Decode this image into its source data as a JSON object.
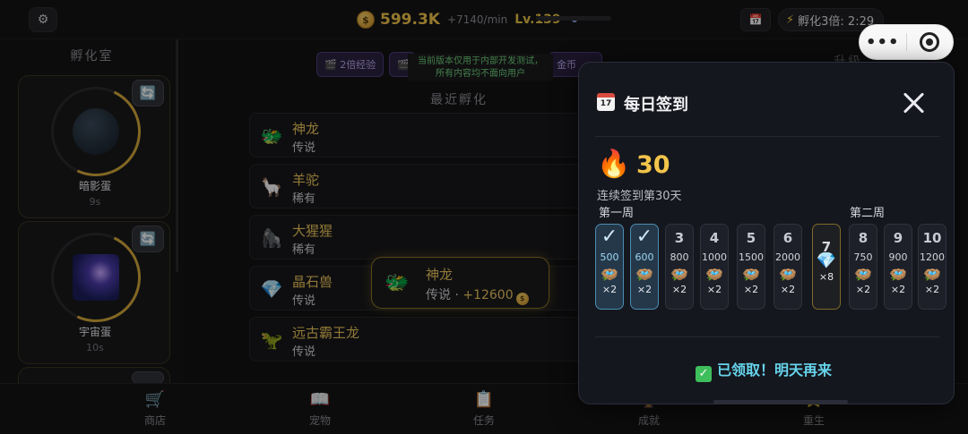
{
  "header": {
    "coins": "599.3K",
    "rate": "+7140/min",
    "level": "Lv.139",
    "level_progress": 0.0,
    "boost": "孵化3倍: 2:29"
  },
  "sidebar": {
    "title": "孵化室",
    "eggs": [
      {
        "name": "暗影蛋",
        "time": "9s",
        "progress": 0.42
      },
      {
        "name": "宇宙蛋",
        "time": "10s",
        "progress": 0.42
      },
      {
        "name": "",
        "time": ""
      }
    ]
  },
  "chips": [
    "2倍经验",
    "",
    "金币"
  ],
  "notice": {
    "line1": "当前版本仅用于内部开发测试，",
    "line2": "所有内容均不面向用户"
  },
  "recent": {
    "title": "最近孵化",
    "items": [
      {
        "icon": "🐲",
        "name": "神龙",
        "rarity": "传说"
      },
      {
        "icon": "🦙",
        "name": "羊驼",
        "rarity": "稀有"
      },
      {
        "icon": "🦍",
        "name": "大猩猩",
        "rarity": "稀有"
      },
      {
        "icon": "💎",
        "name": "晶石兽",
        "rarity": "传说"
      },
      {
        "icon": "🦖",
        "name": "远古霸王龙",
        "rarity": "传说"
      }
    ]
  },
  "toast": {
    "icon": "🐲",
    "name": "神龙",
    "rarity": "传说",
    "separator": "·",
    "reward": "+12600"
  },
  "upgrade_title": "升级",
  "bottom_nav": [
    {
      "icon": "🛒",
      "label": "商店"
    },
    {
      "icon": "📖",
      "label": "宠物"
    },
    {
      "icon": "📋",
      "label": "任务"
    },
    {
      "icon": "🏆",
      "label": "成就"
    },
    {
      "icon": "⭐",
      "label": "重生"
    }
  ],
  "modal": {
    "title": "每日签到",
    "calendar_icon_text": "17",
    "streak": "30",
    "streak_label": "连续签到第30天",
    "week1_label": "第一周",
    "week2_label": "第二周",
    "days": [
      {
        "day": "1",
        "amount": "500",
        "mult": "×2",
        "claimed": true
      },
      {
        "day": "2",
        "amount": "600",
        "mult": "×2",
        "claimed": true
      },
      {
        "day": "3",
        "amount": "800",
        "mult": "×2",
        "claimed": false
      },
      {
        "day": "4",
        "amount": "1000",
        "mult": "×2",
        "claimed": false
      },
      {
        "day": "5",
        "amount": "1500",
        "mult": "×2",
        "claimed": false
      },
      {
        "day": "6",
        "amount": "2000",
        "mult": "×2",
        "claimed": false
      },
      {
        "day": "7",
        "amount": "",
        "mult": "×8",
        "claimed": false,
        "special": true
      },
      {
        "day": "8",
        "amount": "750",
        "mult": "×2",
        "claimed": false
      },
      {
        "day": "9",
        "amount": "900",
        "mult": "×2",
        "claimed": false
      },
      {
        "day": "10",
        "amount": "1200",
        "mult": "×2",
        "claimed": false
      }
    ],
    "claimed_text": "已领取！明天再来"
  }
}
